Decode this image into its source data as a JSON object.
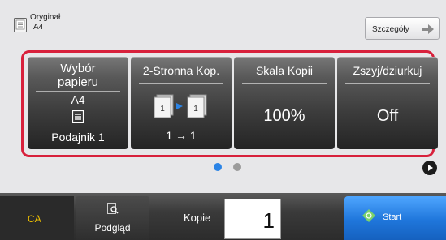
{
  "original": {
    "label": "Oryginał",
    "size": "A4",
    "icon": "document-icon"
  },
  "details_button": {
    "label": "Szczegóły",
    "icon": "arrow-right-icon"
  },
  "tiles": {
    "paper": {
      "title_line1": "Wybór",
      "title_line2": "papieru",
      "size": "A4",
      "icon": "tray-icon",
      "value": "Podajnik 1"
    },
    "duplex": {
      "title": "2-Stronna Kop.",
      "icon": "duplex-copy-icon",
      "value": "1 → 1"
    },
    "scale": {
      "title": "Skala Kopii",
      "value": "100%"
    },
    "staple": {
      "title": "Zszyj/dziurkuj",
      "value": "Off"
    }
  },
  "pagination": {
    "current_page": 1,
    "total_pages": 2,
    "active_color": "#2b84e6"
  },
  "bottom": {
    "ca_label": "CA",
    "preview_label": "Podgląd",
    "copies_label": "Kopie",
    "copies_value": "1",
    "start_label": "Start"
  },
  "colors": {
    "highlight": "#d8213c",
    "start": "#1f76db",
    "ca_text": "#f2c200"
  }
}
